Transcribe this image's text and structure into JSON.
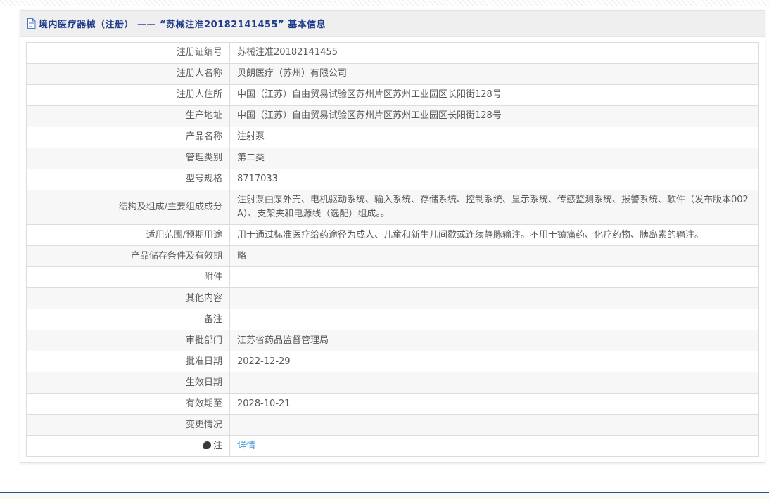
{
  "page": {
    "title": "境内医疗器械（注册） —— “苏械注准20182141455” 基本信息"
  },
  "colors": {
    "title_blue": "#1f3c8d",
    "link_blue": "#4895d9",
    "header_band_bg": "#efefef",
    "row_alt_bg": "#f7f7f7",
    "table_border": "#dcdcdc",
    "footer_line_blue": "#1e5a99"
  },
  "table": {
    "rows": [
      {
        "label": "注册证编号",
        "value": "苏械注准20182141455"
      },
      {
        "label": "注册人名称",
        "value": "贝朗医疗（苏州）有限公司"
      },
      {
        "label": "注册人住所",
        "value": "中国（江苏）自由贸易试验区苏州片区苏州工业园区长阳街128号"
      },
      {
        "label": "生产地址",
        "value": "中国（江苏）自由贸易试验区苏州片区苏州工业园区长阳街128号"
      },
      {
        "label": "产品名称",
        "value": "注射泵"
      },
      {
        "label": "管理类别",
        "value": "第二类"
      },
      {
        "label": "型号规格",
        "value": "8717033"
      },
      {
        "label": "结构及组成/主要组成成分",
        "value": "注射泵由泵外壳、电机驱动系统、输入系统、存储系统、控制系统、显示系统、传感监测系统、报警系统、软件（发布版本002A）、支架夹和电源线（选配）组成。。"
      },
      {
        "label": "适用范围/预期用途",
        "value": "用于通过标准医疗给药途径为成人、儿童和新生儿间歇或连续静脉输注。不用于镇痛药、化疗药物、胰岛素的输注。"
      },
      {
        "label": "产品储存条件及有效期",
        "value": "略"
      },
      {
        "label": "附件",
        "value": ""
      },
      {
        "label": "其他内容",
        "value": ""
      },
      {
        "label": "备注",
        "value": ""
      },
      {
        "label": "审批部门",
        "value": "江苏省药品监督管理局"
      },
      {
        "label": "批准日期",
        "value": "2022-12-29"
      },
      {
        "label": "生效日期",
        "value": ""
      },
      {
        "label": "有效期至",
        "value": "2028-10-21"
      },
      {
        "label": "变更情况",
        "value": ""
      },
      {
        "label": "注",
        "value": "详情",
        "value_type": "link",
        "label_icon": "note-icon"
      }
    ]
  }
}
